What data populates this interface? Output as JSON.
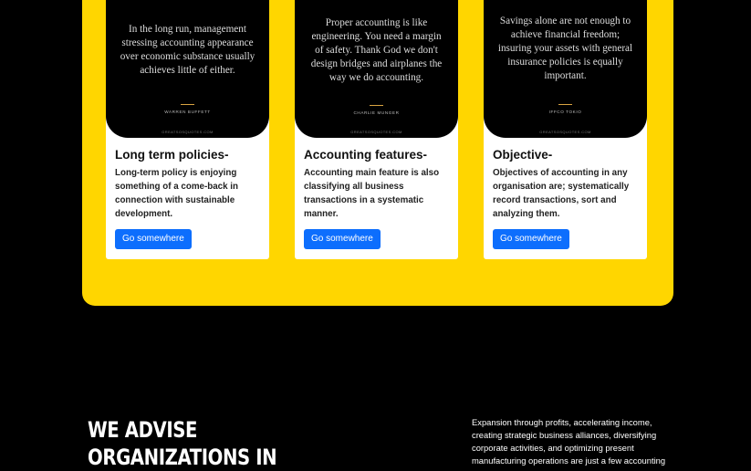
{
  "cards": [
    {
      "quote": "In the long run, management stressing accounting appearance over economic substance usually achieves little of either.",
      "author": "WARREN BUFFETT",
      "site": "GREATSOSQUOTES.COM",
      "title": "Long term policies-",
      "text": "Long-term policy is enjoying something of a come-back in connection with sustainable development.",
      "button": "Go somewhere"
    },
    {
      "quote": "Proper accounting is like engineering. You need a margin of safety. Thank God we don't design bridges and airplanes the way we do accounting.",
      "author": "CHARLIE MUNGER",
      "site": "GREATSOSQUOTES.COM",
      "title": "Accounting features-",
      "text": "Accounting main feature is also classifying all business transactions in a systematic manner.",
      "button": "Go somewhere"
    },
    {
      "quote": "Savings alone are not enough to achieve financial freedom; insuring your assets with general insurance policies is equally important.",
      "author": "IFFCO TOKIO",
      "site": "GREATSOSQUOTES.COM",
      "title": "Objective-",
      "text": "Objectives of accounting in any organisation are; systematically record transactions, sort and analyzing them.",
      "button": "Go somewhere"
    }
  ],
  "quote_mark": "“",
  "advise": {
    "title": "We advise organizations in",
    "text": "Expansion through profits, accelerating income, creating strategic business alliances, diversifying corporate activities, and optimizing present manufacturing operations are just a few accounting"
  },
  "colors": {
    "panel": "#ffd600",
    "button": "#0d6efd",
    "quote_accent": "#d9a441",
    "background": "#000000"
  }
}
